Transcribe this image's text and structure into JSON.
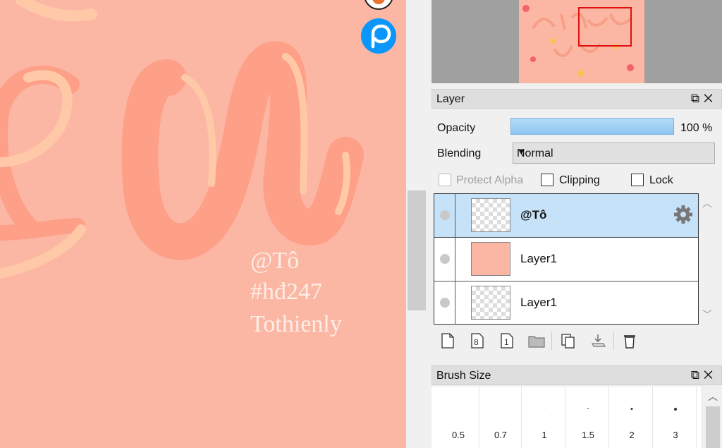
{
  "canvas": {
    "watermark_lines": [
      "@Tô",
      "#hđ247",
      "Tothienly"
    ],
    "background": "#fbb7a4",
    "app_icon": "pixiv-p-icon"
  },
  "layer_panel": {
    "title": "Layer",
    "opacity_label": "Opacity",
    "opacity_value": "100 %",
    "opacity_fraction": 1.0,
    "blending_label": "Blending",
    "blending_value": "Normal",
    "protect_alpha_label": "Protect Alpha",
    "clipping_label": "Clipping",
    "lock_label": "Lock",
    "layers": [
      {
        "name": "@Tô",
        "selected": true
      },
      {
        "name": "Layer1",
        "selected": false
      },
      {
        "name": "Layer1",
        "selected": false
      }
    ],
    "toolbar_icons": [
      "new-layer-icon",
      "new-8bit-layer-icon",
      "new-1bit-layer-icon",
      "folder-icon",
      "copy-layer-icon",
      "merge-down-icon",
      "trash-icon"
    ]
  },
  "brush_panel": {
    "title": "Brush Size",
    "sizes": [
      "0.5",
      "0.7",
      "1",
      "1.5",
      "2",
      "3"
    ]
  },
  "colors": {
    "accent": "#8cc6f3",
    "selected_row": "#c6e2f9",
    "nav_rect": "#e01010"
  }
}
